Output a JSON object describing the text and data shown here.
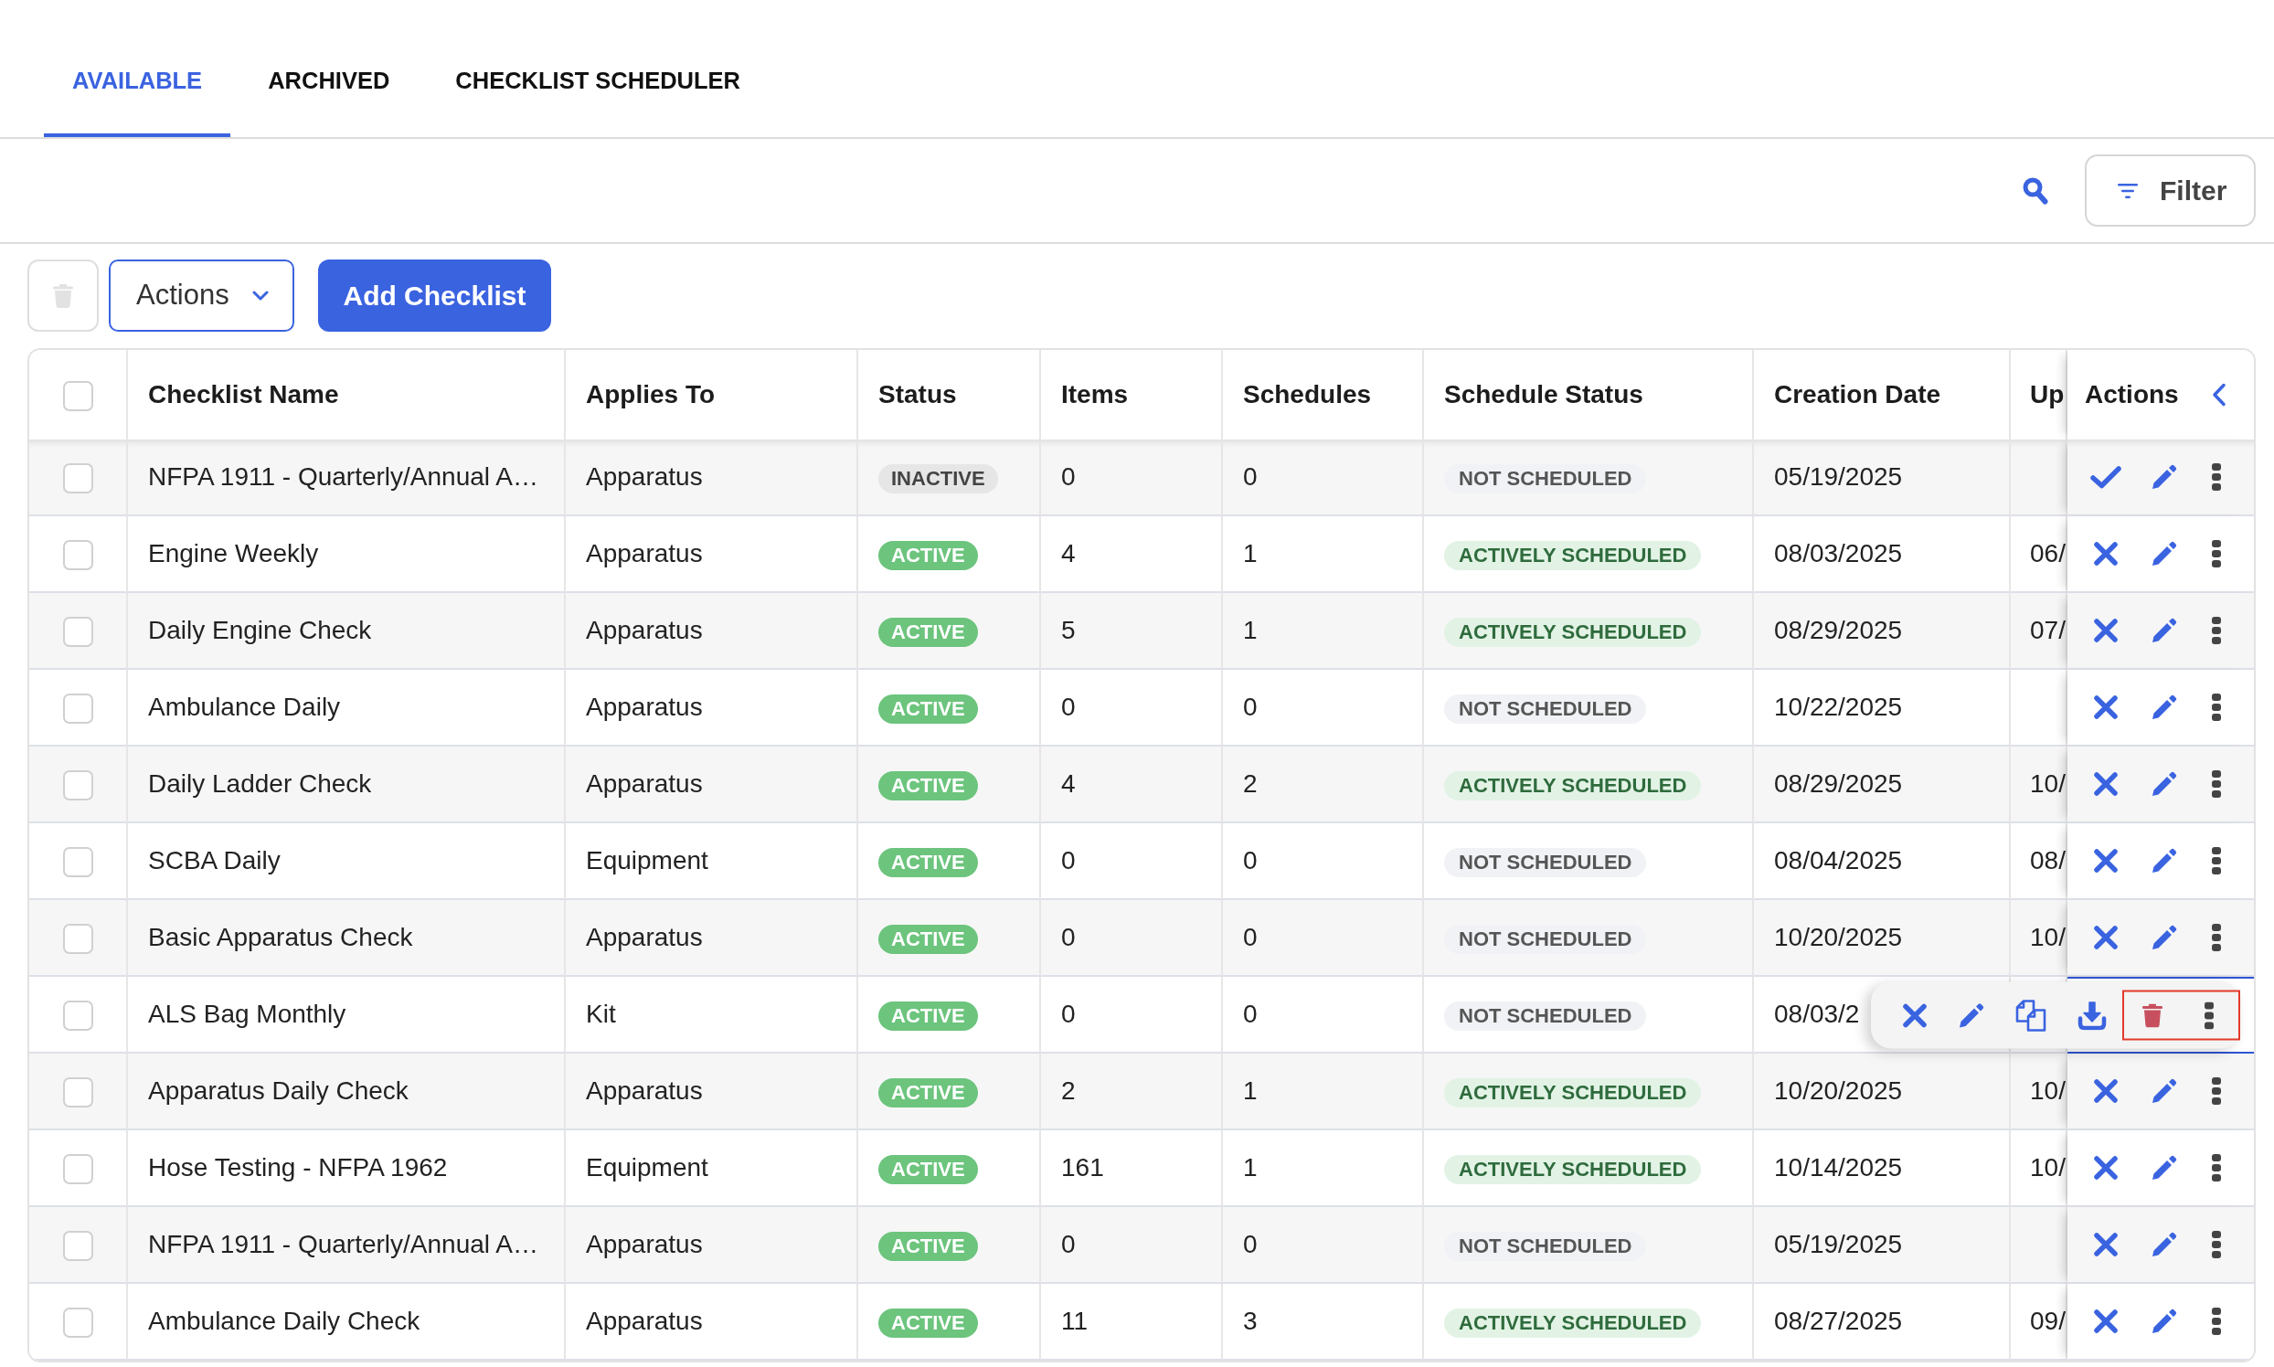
{
  "tabs": [
    {
      "label": "AVAILABLE",
      "selected": true
    },
    {
      "label": "ARCHIVED",
      "selected": false
    },
    {
      "label": "CHECKLIST SCHEDULER",
      "selected": false
    }
  ],
  "filter_button": {
    "label": "Filter"
  },
  "toolbar": {
    "delete_disabled": true,
    "actions_label": "Actions",
    "add_label": "Add Checklist"
  },
  "table": {
    "select_all": {
      "checked": false
    },
    "columns": [
      "Checklist Name",
      "Applies To",
      "Status",
      "Items",
      "Schedules",
      "Schedule Status",
      "Creation Date",
      "Up",
      "Actions"
    ],
    "rows": [
      {
        "checked": false,
        "name": "NFPA 1911 - Quarterly/Annual A…",
        "applies_to": "Apparatus",
        "status": {
          "label": "INACTIVE",
          "active": false
        },
        "items": "0",
        "schedules": "0",
        "schedule_status": {
          "label": "NOT SCHEDULED",
          "scheduled": false
        },
        "creation_date": "05/19/2025"
      },
      {
        "checked": false,
        "name": "Engine Weekly",
        "applies_to": "Apparatus",
        "status": {
          "label": "ACTIVE",
          "active": true
        },
        "items": "4",
        "schedules": "1",
        "schedule_status": {
          "label": "ACTIVELY SCHEDULED",
          "scheduled": true
        },
        "creation_date": "08/03/2025",
        "column_9": "06/"
      },
      {
        "checked": false,
        "name": "Daily Engine Check",
        "applies_to": "Apparatus",
        "status": {
          "label": "ACTIVE",
          "active": true
        },
        "items": "5",
        "schedules": "1",
        "schedule_status": {
          "label": "ACTIVELY SCHEDULED",
          "scheduled": true
        },
        "creation_date": "08/29/2025",
        "column_9": "07/"
      },
      {
        "checked": false,
        "name": "Ambulance Daily",
        "applies_to": "Apparatus",
        "status": {
          "label": "ACTIVE",
          "active": true
        },
        "items": "0",
        "schedules": "0",
        "schedule_status": {
          "label": "NOT SCHEDULED",
          "scheduled": false
        },
        "creation_date": "10/22/2025"
      },
      {
        "checked": false,
        "name": "Daily Ladder Check",
        "applies_to": "Apparatus",
        "status": {
          "label": "ACTIVE",
          "active": true
        },
        "items": "4",
        "schedules": "2",
        "schedule_status": {
          "label": "ACTIVELY SCHEDULED",
          "scheduled": true
        },
        "creation_date": "08/29/2025",
        "column_9": "10/"
      },
      {
        "checked": false,
        "name": "SCBA Daily",
        "applies_to": "Equipment",
        "status": {
          "label": "ACTIVE",
          "active": true
        },
        "items": "0",
        "schedules": "0",
        "schedule_status": {
          "label": "NOT SCHEDULED",
          "scheduled": false
        },
        "creation_date": "08/04/2025",
        "column_9": "08/"
      },
      {
        "checked": false,
        "name": "Basic Apparatus Check",
        "applies_to": "Apparatus",
        "status": {
          "label": "ACTIVE",
          "active": true
        },
        "items": "0",
        "schedules": "0",
        "schedule_status": {
          "label": "NOT SCHEDULED",
          "scheduled": false
        },
        "creation_date": "10/20/2025",
        "column_9": "10/"
      },
      {
        "checked": false,
        "name": "ALS Bag Monthly",
        "applies_to": "Kit",
        "status": {
          "label": "ACTIVE",
          "active": true
        },
        "items": "0",
        "schedules": "0",
        "schedule_status": {
          "label": "NOT SCHEDULED",
          "scheduled": false
        },
        "creation_date": "08/03/2",
        "menu": {
          "items": [
            {
              "kind": "deactivate",
              "highlighted": false
            },
            {
              "kind": "edit",
              "highlighted": false
            },
            {
              "kind": "copy",
              "highlighted": false
            },
            {
              "kind": "download",
              "highlighted": false
            },
            {
              "kind": "delete",
              "highlighted": true
            },
            {
              "kind": "more",
              "highlighted": true
            }
          ]
        }
      },
      {
        "checked": false,
        "name": "Apparatus Daily Check",
        "applies_to": "Apparatus",
        "status": {
          "label": "ACTIVE",
          "active": true
        },
        "items": "2",
        "schedules": "1",
        "schedule_status": {
          "label": "ACTIVELY SCHEDULED",
          "scheduled": true
        },
        "creation_date": "10/20/2025",
        "column_9": "10/"
      },
      {
        "checked": false,
        "name": "Hose Testing - NFPA 1962",
        "applies_to": "Equipment",
        "status": {
          "label": "ACTIVE",
          "active": true
        },
        "items": "161",
        "schedules": "1",
        "schedule_status": {
          "label": "ACTIVELY SCHEDULED",
          "scheduled": true
        },
        "creation_date": "10/14/2025",
        "column_9": "10/"
      },
      {
        "checked": false,
        "name": "NFPA 1911 - Quarterly/Annual A…",
        "applies_to": "Apparatus",
        "status": {
          "label": "ACTIVE",
          "active": true
        },
        "items": "0",
        "schedules": "0",
        "schedule_status": {
          "label": "NOT SCHEDULED",
          "scheduled": false
        },
        "creation_date": "05/19/2025"
      },
      {
        "checked": false,
        "name": "Ambulance Daily Check",
        "applies_to": "Apparatus",
        "status": {
          "label": "ACTIVE",
          "active": true
        },
        "items": "11",
        "schedules": "3",
        "schedule_status": {
          "label": "ACTIVELY SCHEDULED",
          "scheduled": true
        },
        "creation_date": "08/27/2025",
        "column_9": "09/"
      }
    ]
  }
}
